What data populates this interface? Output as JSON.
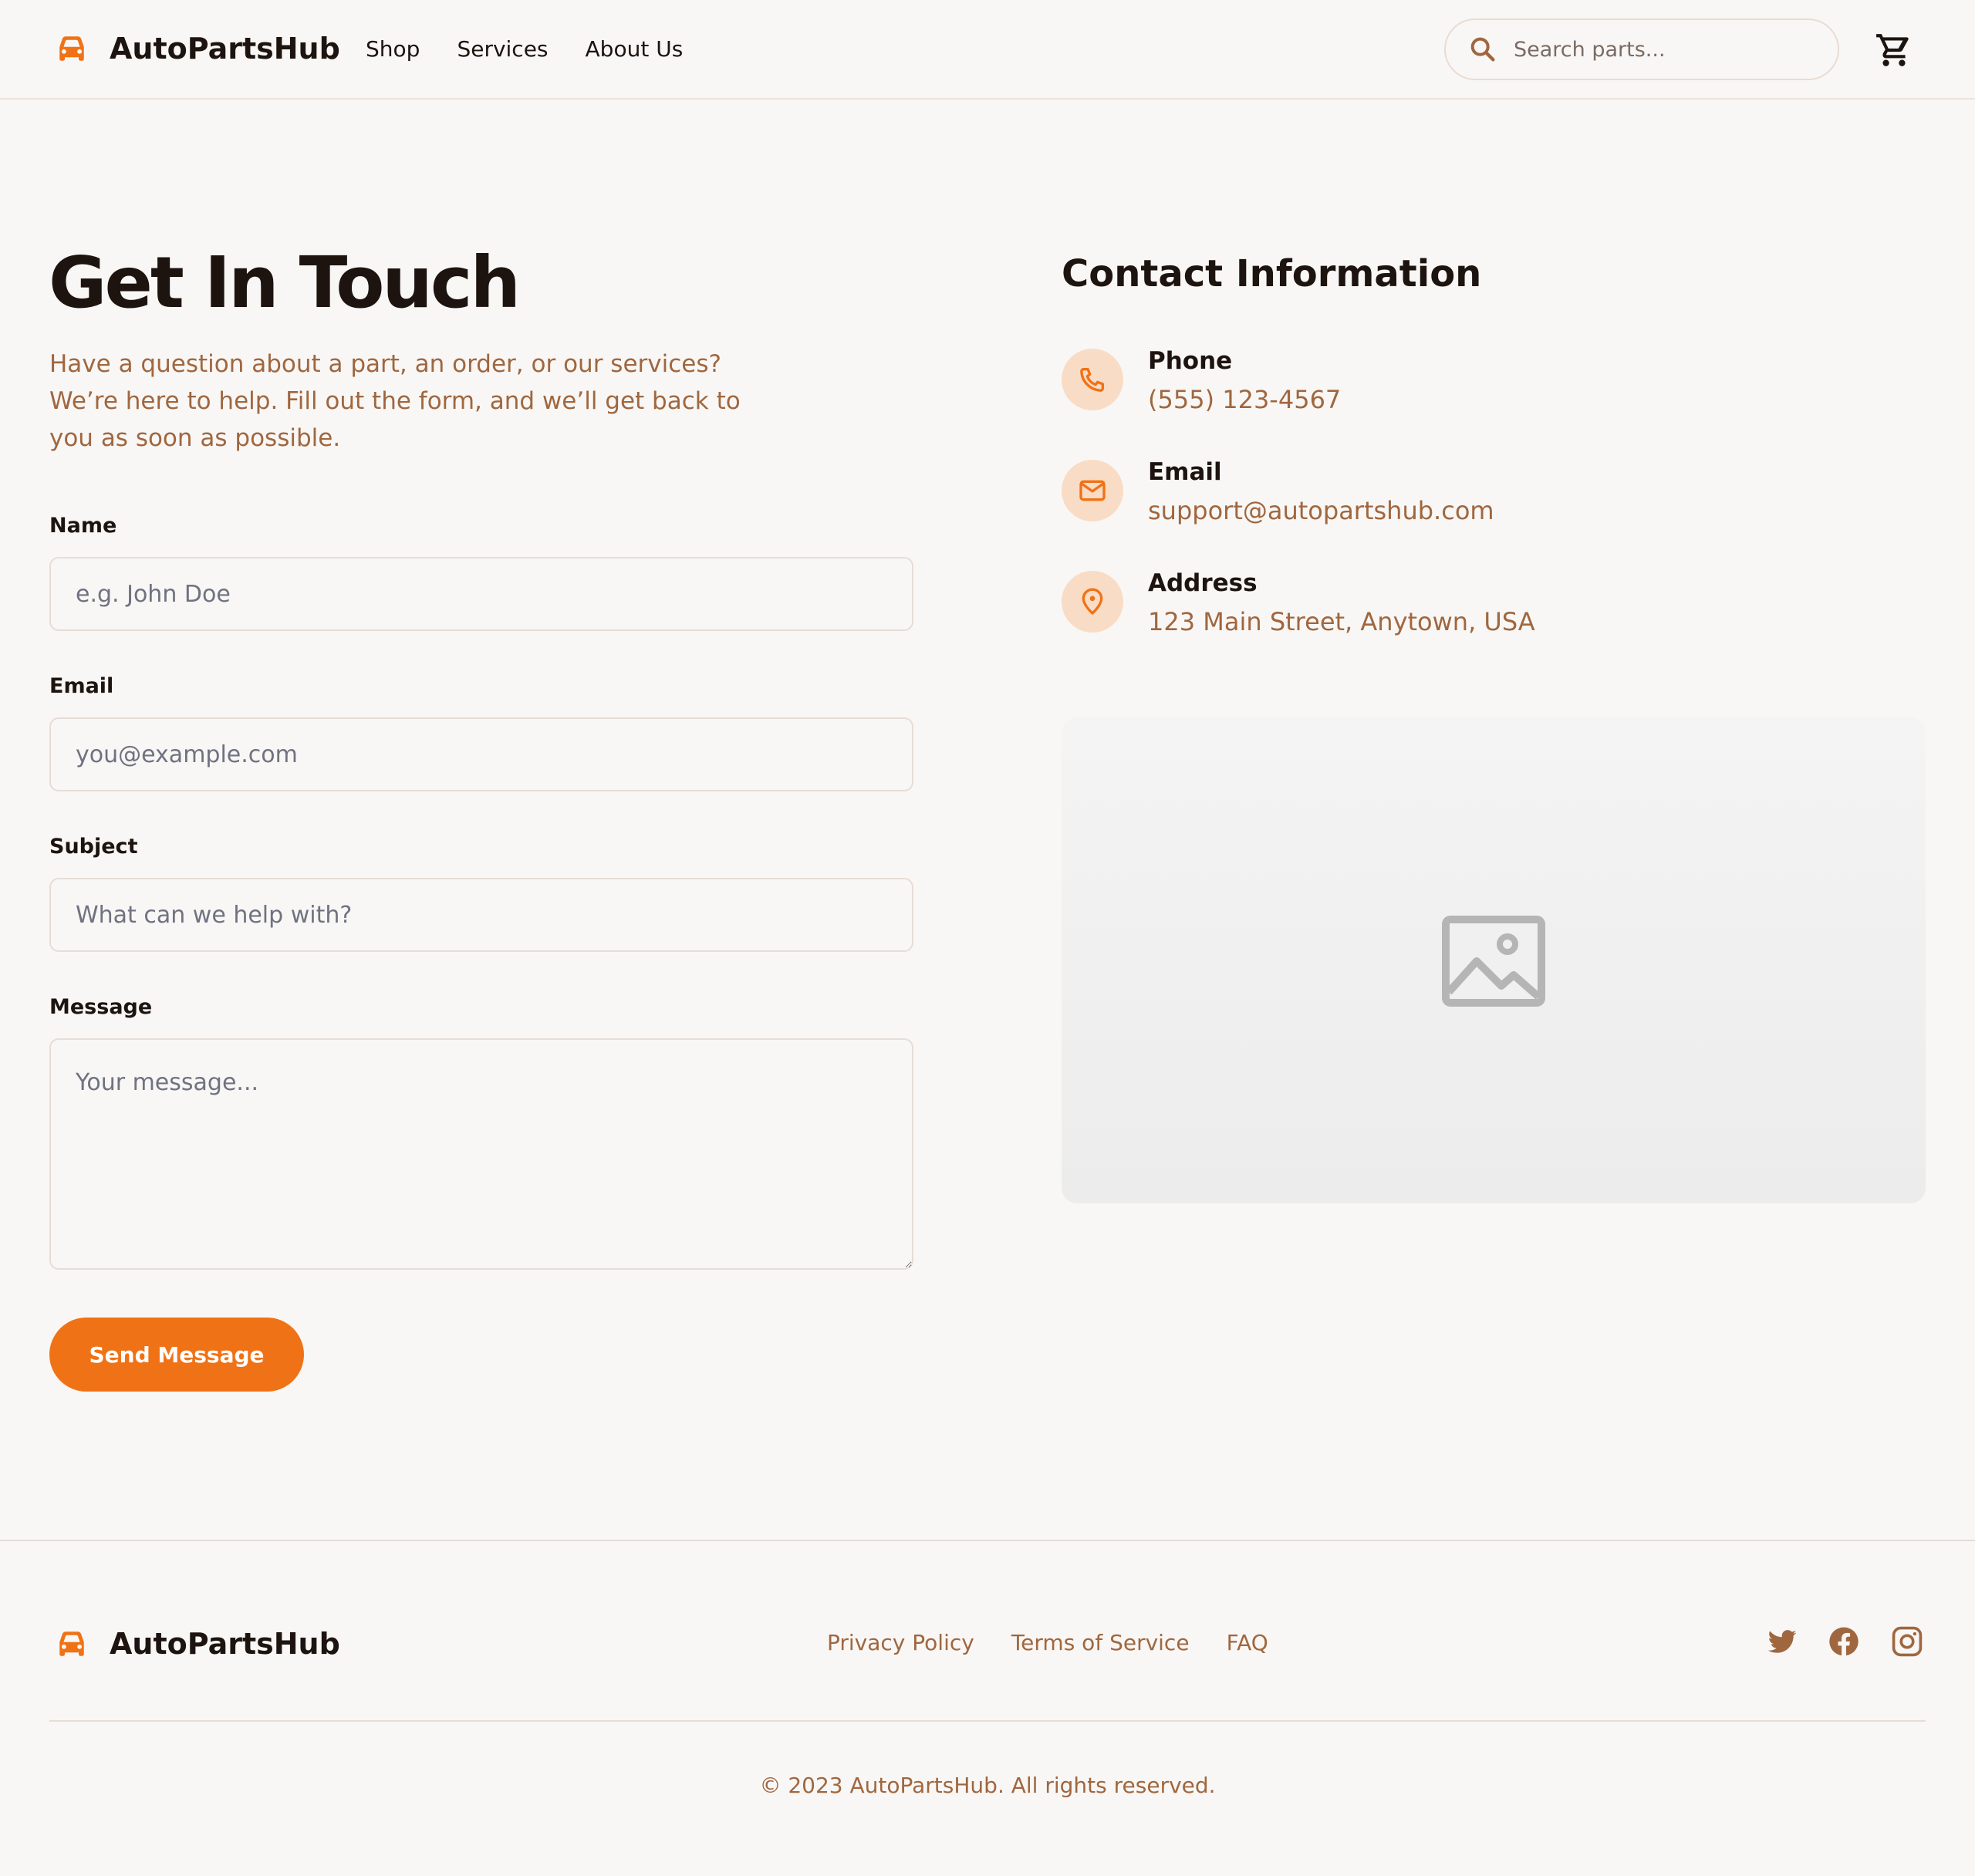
{
  "brand": {
    "name": "AutoPartsHub"
  },
  "nav": {
    "items": [
      {
        "label": "Shop"
      },
      {
        "label": "Services"
      },
      {
        "label": "About Us"
      }
    ]
  },
  "search": {
    "placeholder": "Search parts..."
  },
  "icons": {
    "logo": "car-icon",
    "search": "search-icon",
    "cart": "cart-icon",
    "phone": "phone-icon",
    "email": "mail-icon",
    "address": "map-pin-icon",
    "image": "image-placeholder-icon",
    "social": [
      "twitter-icon",
      "facebook-icon",
      "instagram-icon"
    ]
  },
  "colors": {
    "accent": "#f07216",
    "accent_soft": "#f9dcc5",
    "muted_text": "#a0673f",
    "text": "#1d1410",
    "background": "#f8f7f5"
  },
  "contact_form": {
    "title": "Get In Touch",
    "intro": "Have a question about a part, an order, or our services? We’re here to help. Fill out the form, and we’ll get back to you as soon as possible.",
    "fields": {
      "name": {
        "label": "Name",
        "placeholder": "e.g. John Doe",
        "value": ""
      },
      "email": {
        "label": "Email",
        "placeholder": "you@example.com",
        "value": ""
      },
      "subject": {
        "label": "Subject",
        "placeholder": "What can we help with?",
        "value": ""
      },
      "message": {
        "label": "Message",
        "placeholder": "Your message...",
        "value": ""
      }
    },
    "submit_label": "Send Message"
  },
  "contact_info": {
    "title": "Contact Information",
    "items": [
      {
        "label": "Phone",
        "value": "(555) 123-4567"
      },
      {
        "label": "Email",
        "value": "support@autopartshub.com"
      },
      {
        "label": "Address",
        "value": "123 Main Street, Anytown, USA"
      }
    ]
  },
  "footer": {
    "links": [
      {
        "label": "Privacy Policy"
      },
      {
        "label": "Terms of Service"
      },
      {
        "label": "FAQ"
      }
    ],
    "copyright": "© 2023 AutoPartsHub. All rights reserved."
  }
}
